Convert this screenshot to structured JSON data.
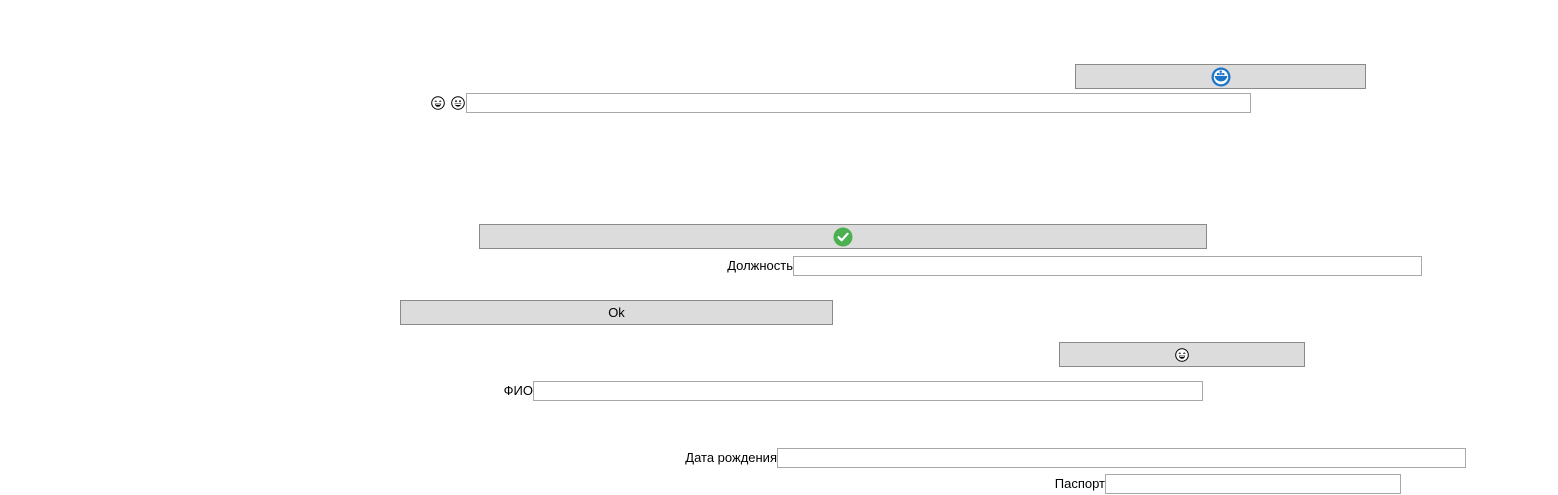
{
  "colors": {
    "button_bg": "#dcdcdc",
    "button_border": "#8a8a8a",
    "input_border": "#a8a8a8",
    "docker_blue": "#1d75c8",
    "check_green": "#4caf50"
  },
  "top_button": {
    "icon": "ship-containers-icon"
  },
  "emoji_row": {
    "icons": [
      "laughing-face-icon",
      "grinning-face-icon"
    ],
    "input_value": ""
  },
  "check_button": {
    "icon": "check-circle-icon"
  },
  "position_field": {
    "label": "Должность",
    "value": ""
  },
  "ok_button": {
    "label": "Ok"
  },
  "emoji_button": {
    "icon": "laughing-face-icon"
  },
  "fio_field": {
    "label": "ФИО",
    "value": ""
  },
  "birthdate_field": {
    "label": "Дата рождения",
    "value": ""
  },
  "passport_field": {
    "label": "Паспорт",
    "value": ""
  }
}
